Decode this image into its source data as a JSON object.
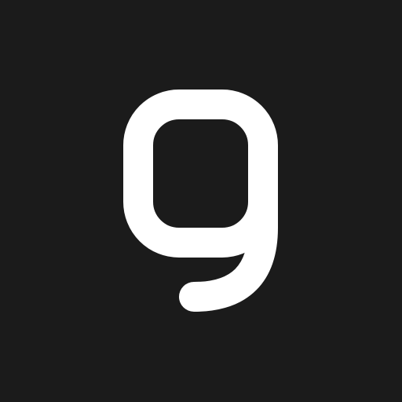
{
  "icon": {
    "name": "g-logo-icon",
    "letter": "g",
    "background_color": "#1b1b1b",
    "glyph_color": "#ffffff"
  }
}
